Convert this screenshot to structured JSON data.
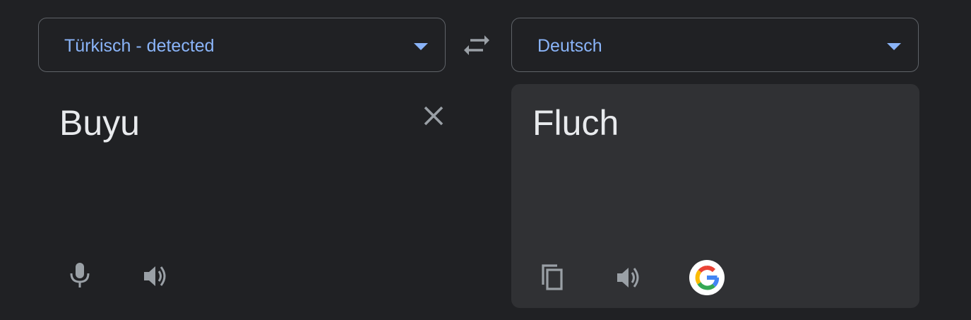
{
  "source_language": {
    "label": "Türkisch - detected"
  },
  "target_language": {
    "label": "Deutsch"
  },
  "source_pane": {
    "text": "Buyu"
  },
  "target_pane": {
    "text": "Fluch"
  },
  "icons": {
    "swap": "swap-languages-icon",
    "clear": "close-icon",
    "microphone": "microphone-icon",
    "source_speaker": "speaker-icon",
    "copy": "copy-icon",
    "target_speaker": "speaker-icon",
    "google": "google-logo-icon"
  },
  "colors": {
    "background": "#202124",
    "panel": "#303134",
    "accent": "#8ab4f8",
    "text": "#e8eaed",
    "icon": "#9aa0a6",
    "border": "#5f6368"
  }
}
